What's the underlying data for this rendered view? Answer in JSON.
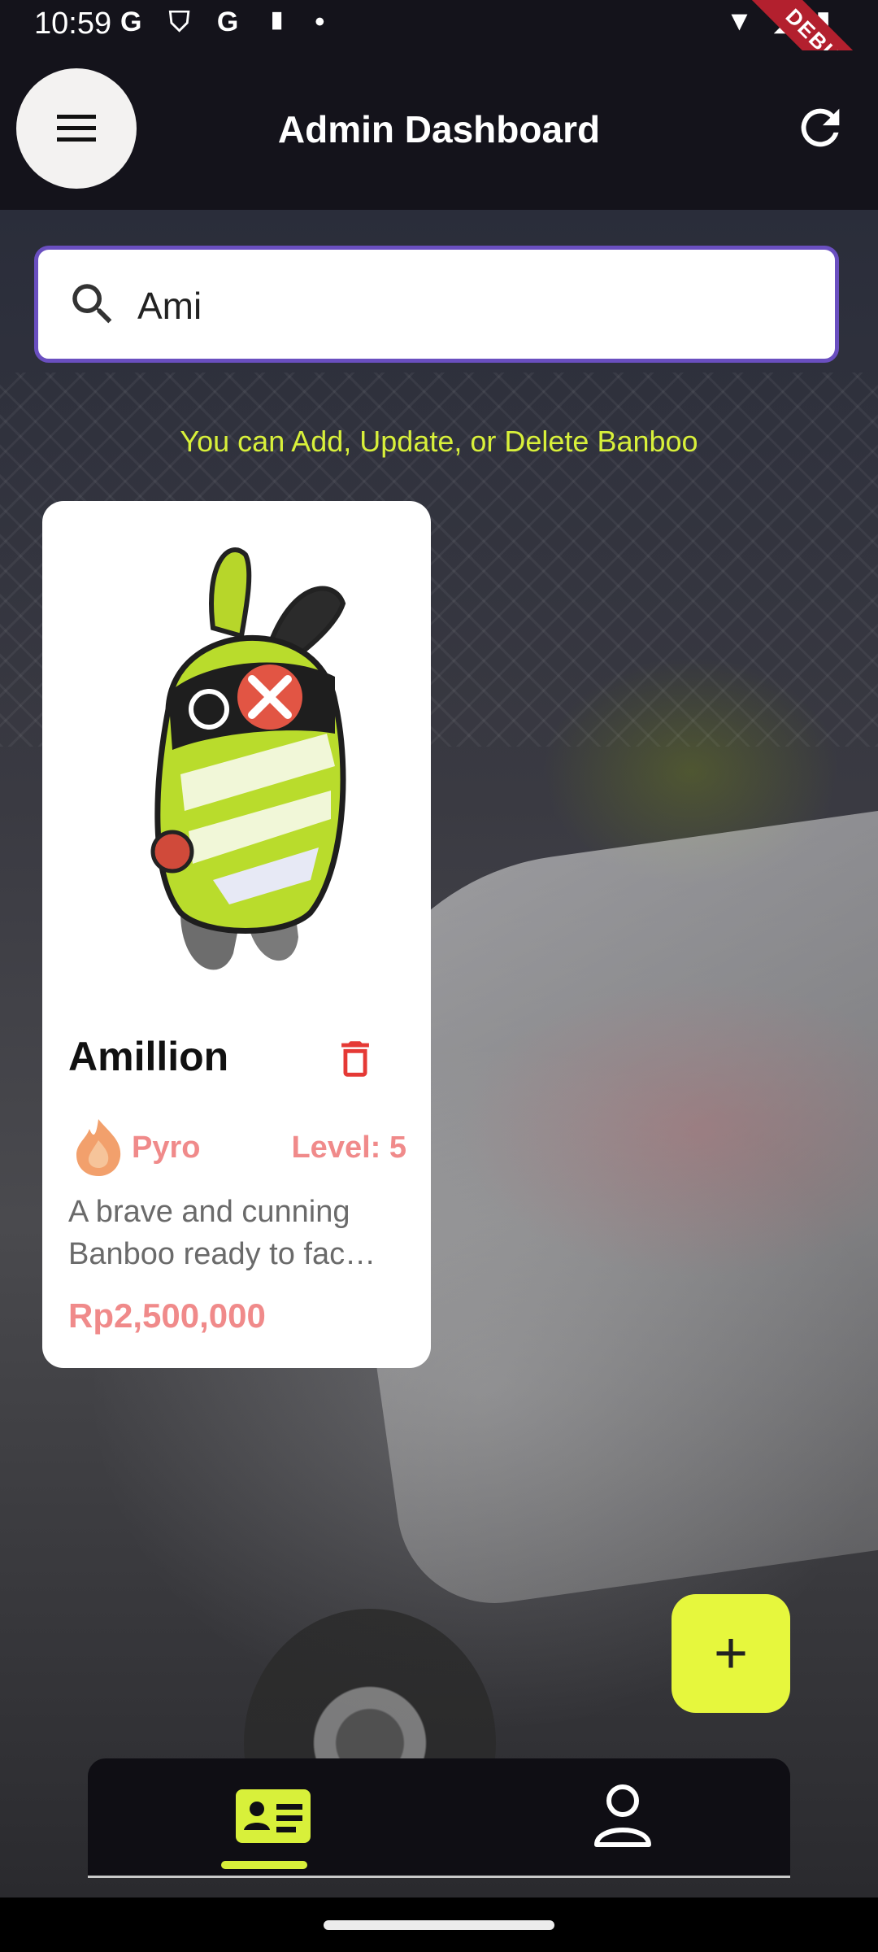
{
  "status_bar": {
    "time": "10:59",
    "left_icons": [
      "google-g",
      "shield",
      "google-g",
      "sd-card",
      "dot"
    ],
    "right_icons": [
      "wifi",
      "signal",
      "battery"
    ],
    "debug_banner": "DEBUG"
  },
  "app_bar": {
    "title": "Admin Dashboard",
    "menu_icon": "hamburger-menu",
    "refresh_icon": "refresh"
  },
  "search": {
    "value": "Ami",
    "icon": "search"
  },
  "hint_text": "You can Add, Update, or Delete Banboo",
  "cards": [
    {
      "name": "Amillion",
      "element": "Pyro",
      "level": "Level: 5",
      "description": "A brave and cunning Banboo ready to fac…",
      "price": "Rp2,500,000",
      "image": "amillion-banboo",
      "delete_icon": "trash"
    }
  ],
  "fab": {
    "label": "+"
  },
  "bottom_nav": {
    "items": [
      {
        "name": "banboo-cards",
        "icon": "id-card",
        "active": true
      },
      {
        "name": "profile",
        "icon": "person",
        "active": false
      }
    ]
  },
  "colors": {
    "accent": "#E6F73D",
    "hint": "#D8F03A",
    "pink": "#F08A8A",
    "search_border": "#6A4FC0",
    "app_bar": "#14131B",
    "delete": "#E53935"
  }
}
